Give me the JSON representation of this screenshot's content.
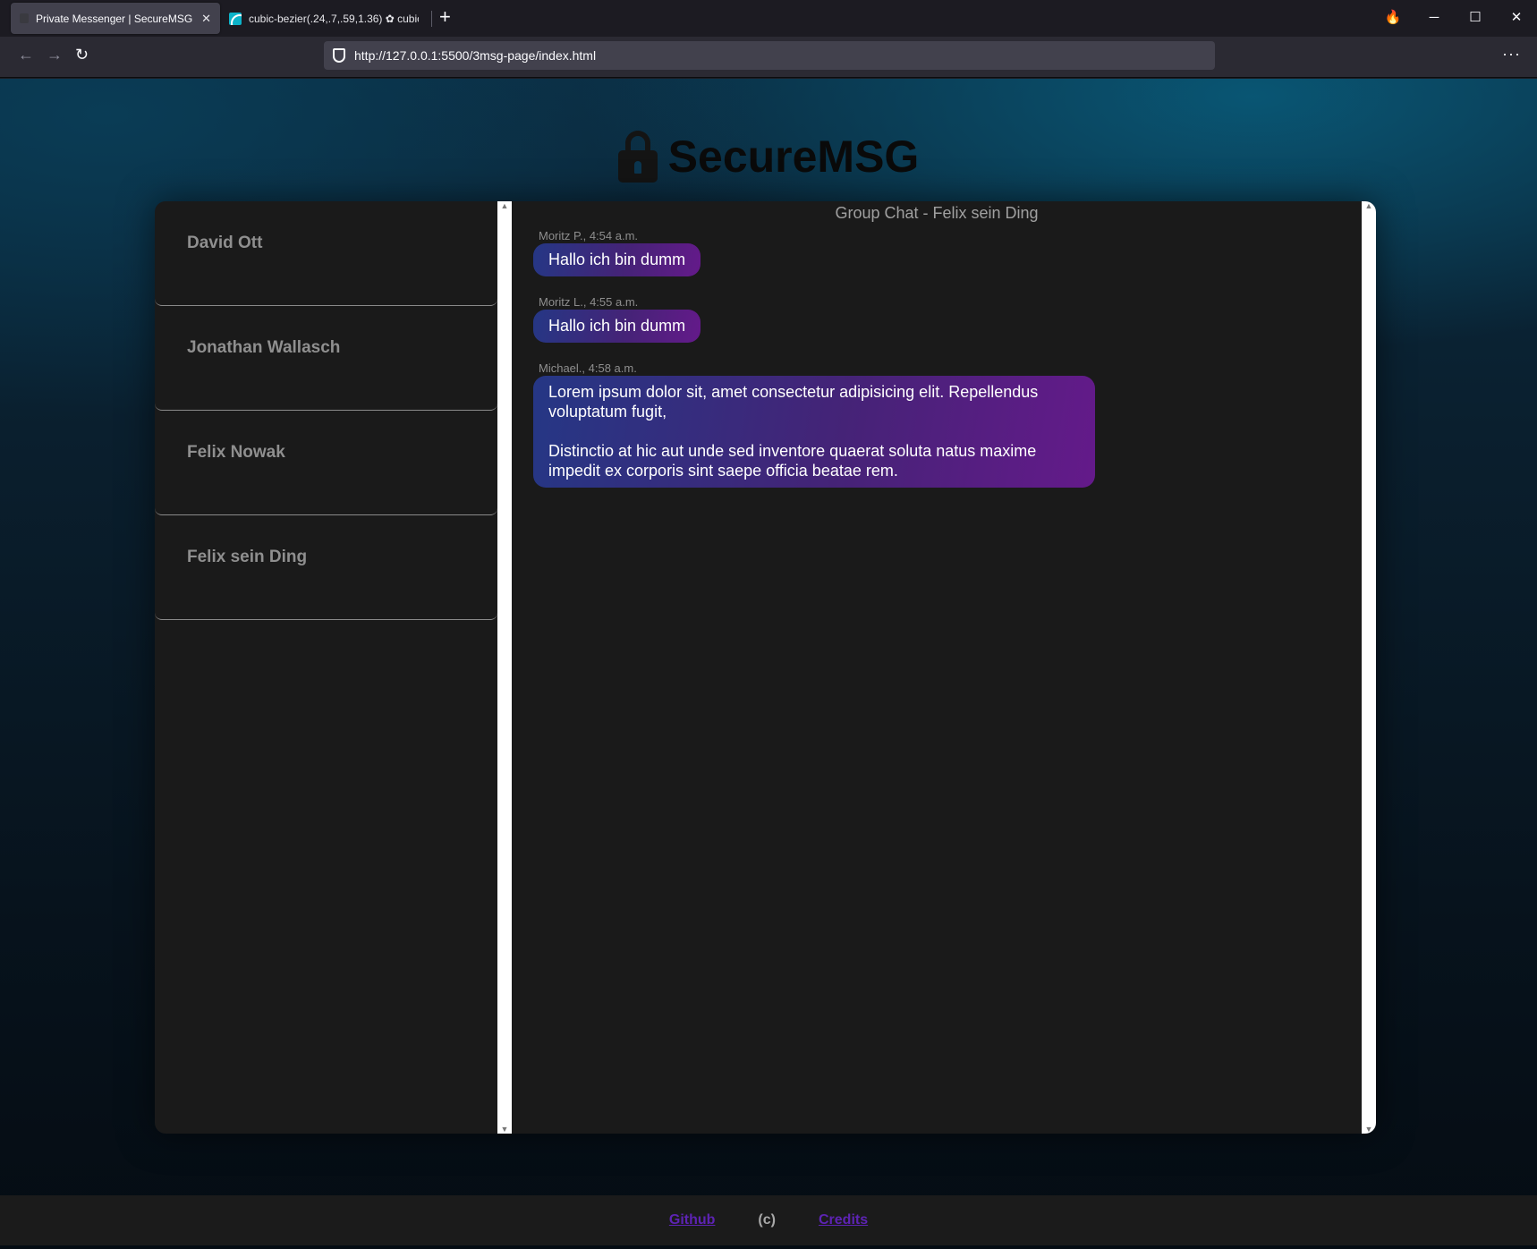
{
  "browser": {
    "tabs": [
      {
        "title": "Private Messenger | SecureMSG",
        "close": "✕",
        "active": true
      },
      {
        "title": "cubic-bezier(.24,.7,.59,1.36) ✿ cubic-b…",
        "active": false
      }
    ],
    "new_tab": "+",
    "url": "http://127.0.0.1:5500/3msg-page/index.html",
    "window_controls": {
      "minimize": "─",
      "maximize": "☐",
      "close": "✕"
    },
    "menu": "···",
    "nav": {
      "back": "←",
      "forward": "→",
      "reload": "↻"
    }
  },
  "app": {
    "title": "SecureMSG",
    "contacts": [
      "David Ott",
      "Jonathan Wallasch",
      "Felix Nowak",
      "Felix sein Ding"
    ],
    "chat_title": "Group Chat - Felix sein Ding",
    "messages": [
      {
        "meta": "Moritz P., 4:54 a.m.",
        "text": [
          "Hallo ich bin dumm"
        ]
      },
      {
        "meta": "Moritz L., 4:55 a.m.",
        "text": [
          "Hallo ich bin dumm"
        ]
      },
      {
        "meta": "Michael., 4:58 a.m.",
        "text": [
          "Lorem ipsum dolor sit, amet consectetur adipisicing elit. Repellendus voluptatum fugit,",
          "Distinctio at hic aut unde sed inventore quaerat soluta natus maxime impedit ex corporis sint saepe officia beatae rem."
        ]
      }
    ],
    "footer": {
      "github": "Github",
      "copyright": "(c)",
      "credits": "Credits"
    },
    "scroll": {
      "up": "▲",
      "down": "▼"
    }
  },
  "colors": {
    "bubble_start": "#253785",
    "bubble_end": "#641a8a",
    "link": "#5d23b3"
  }
}
